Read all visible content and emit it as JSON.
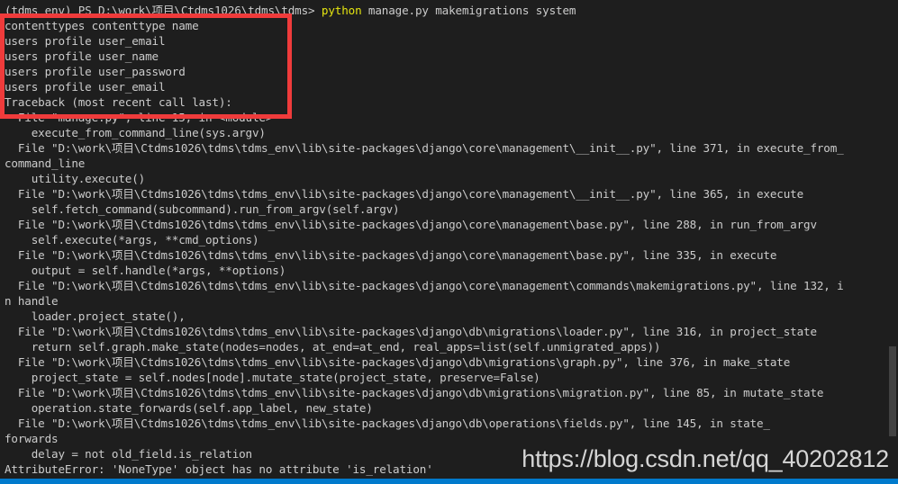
{
  "terminal": {
    "prompt": "(tdms_env) PS D:\\work\\项目\\Ctdms1026\\tdms\\tdms> ",
    "command_program": "python",
    "command_args": " manage.py makemigrations system",
    "output_lines": [
      "contenttypes contenttype name",
      "users profile user_email",
      "users profile user_name",
      "users profile user_password",
      "users profile user_email",
      "Traceback (most recent call last):",
      "  File \"manage.py\", line 15, in <module>",
      "    execute_from_command_line(sys.argv)",
      "  File \"D:\\work\\项目\\Ctdms1026\\tdms\\tdms_env\\lib\\site-packages\\django\\core\\management\\__init__.py\", line 371, in execute_from_",
      "command_line",
      "    utility.execute()",
      "  File \"D:\\work\\项目\\Ctdms1026\\tdms\\tdms_env\\lib\\site-packages\\django\\core\\management\\__init__.py\", line 365, in execute",
      "    self.fetch_command(subcommand).run_from_argv(self.argv)",
      "  File \"D:\\work\\项目\\Ctdms1026\\tdms\\tdms_env\\lib\\site-packages\\django\\core\\management\\base.py\", line 288, in run_from_argv",
      "    self.execute(*args, **cmd_options)",
      "  File \"D:\\work\\项目\\Ctdms1026\\tdms\\tdms_env\\lib\\site-packages\\django\\core\\management\\base.py\", line 335, in execute",
      "    output = self.handle(*args, **options)",
      "  File \"D:\\work\\项目\\Ctdms1026\\tdms\\tdms_env\\lib\\site-packages\\django\\core\\management\\commands\\makemigrations.py\", line 132, i",
      "n handle",
      "    loader.project_state(),",
      "  File \"D:\\work\\项目\\Ctdms1026\\tdms\\tdms_env\\lib\\site-packages\\django\\db\\migrations\\loader.py\", line 316, in project_state",
      "    return self.graph.make_state(nodes=nodes, at_end=at_end, real_apps=list(self.unmigrated_apps))",
      "  File \"D:\\work\\项目\\Ctdms1026\\tdms\\tdms_env\\lib\\site-packages\\django\\db\\migrations\\graph.py\", line 376, in make_state",
      "    project_state = self.nodes[node].mutate_state(project_state, preserve=False)",
      "  File \"D:\\work\\项目\\Ctdms1026\\tdms\\tdms_env\\lib\\site-packages\\django\\db\\migrations\\migration.py\", line 85, in mutate_state",
      "    operation.state_forwards(self.app_label, new_state)",
      "  File \"D:\\work\\项目\\Ctdms1026\\tdms\\tdms_env\\lib\\site-packages\\django\\db\\operations\\fields.py\", line 145, in state_",
      "forwards",
      "    delay = not old_field.is_relation",
      "AttributeError: 'NoneType' object has no attribute 'is_relation'"
    ]
  },
  "annotation": {
    "highlight_color": "#ef3b3b"
  },
  "watermark": "https://blog.csdn.net/qq_40202812",
  "colors": {
    "background": "#1e1e1e",
    "text": "#cccccc",
    "command": "#e5e510",
    "status_bar": "#007acc"
  }
}
